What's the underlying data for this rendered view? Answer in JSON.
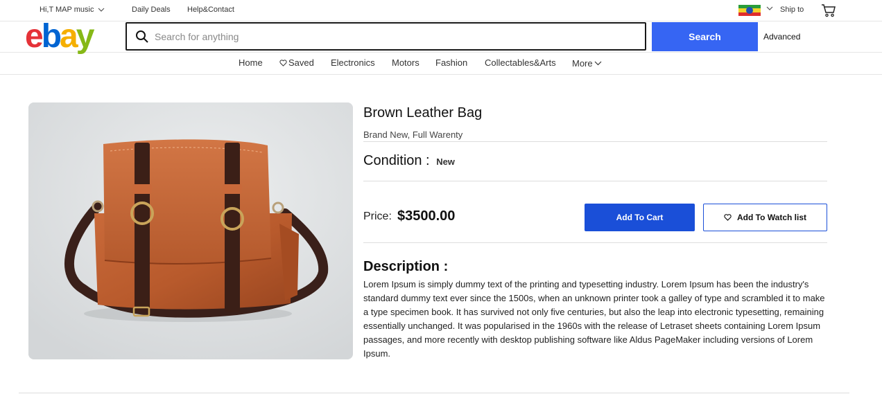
{
  "topbar": {
    "greeting": "Hi,T MAP music",
    "daily_deals": "Daily Deals",
    "help_contact": "Help&Contact",
    "ship_to": "Ship to"
  },
  "header": {
    "logo_letters": [
      "e",
      "b",
      "a",
      "y"
    ],
    "search_placeholder": "Search for anything",
    "search_button": "Search",
    "advanced": "Advanced"
  },
  "nav": {
    "items": [
      "Home",
      "Saved",
      "Electronics",
      "Motors",
      "Fashion",
      "Collectables&Arts",
      "More"
    ]
  },
  "product": {
    "title": "Brown Leather Bag",
    "subtitle": "Brand New, Full Warenty",
    "condition_label": "Condition :",
    "condition_value": "New",
    "price_label": "Price:",
    "price_value": "$3500.00",
    "add_to_cart": "Add To Cart",
    "add_to_watchlist": "Add To Watch list",
    "description_title": "Description :",
    "description": "Lorem Ipsum is simply dummy text of the printing and typesetting industry. Lorem Ipsum has been the industry's standard dummy text ever since the 1500s, when an unknown printer took a galley of type and scrambled it to make a type specimen book. It has survived not only five centuries, but also the leap into electronic typesetting, remaining essentially unchanged. It was popularised in the 1960s with the release of Letraset sheets containing Lorem Ipsum passages, and more recently with desktop publishing software like Aldus PageMaker including versions of Lorem Ipsum."
  },
  "colors": {
    "accent_blue": "#3665f3",
    "cart_button": "#1a4fd8",
    "logo_red": "#e53238",
    "logo_blue": "#0064d2",
    "logo_yellow": "#f5af02",
    "logo_green": "#86b817"
  },
  "icons": {
    "search": "search-icon",
    "cart": "shopping-cart-icon",
    "heart": "heart-icon",
    "chevron": "chevron-down-icon",
    "flag": "ethiopia-flag-icon"
  }
}
